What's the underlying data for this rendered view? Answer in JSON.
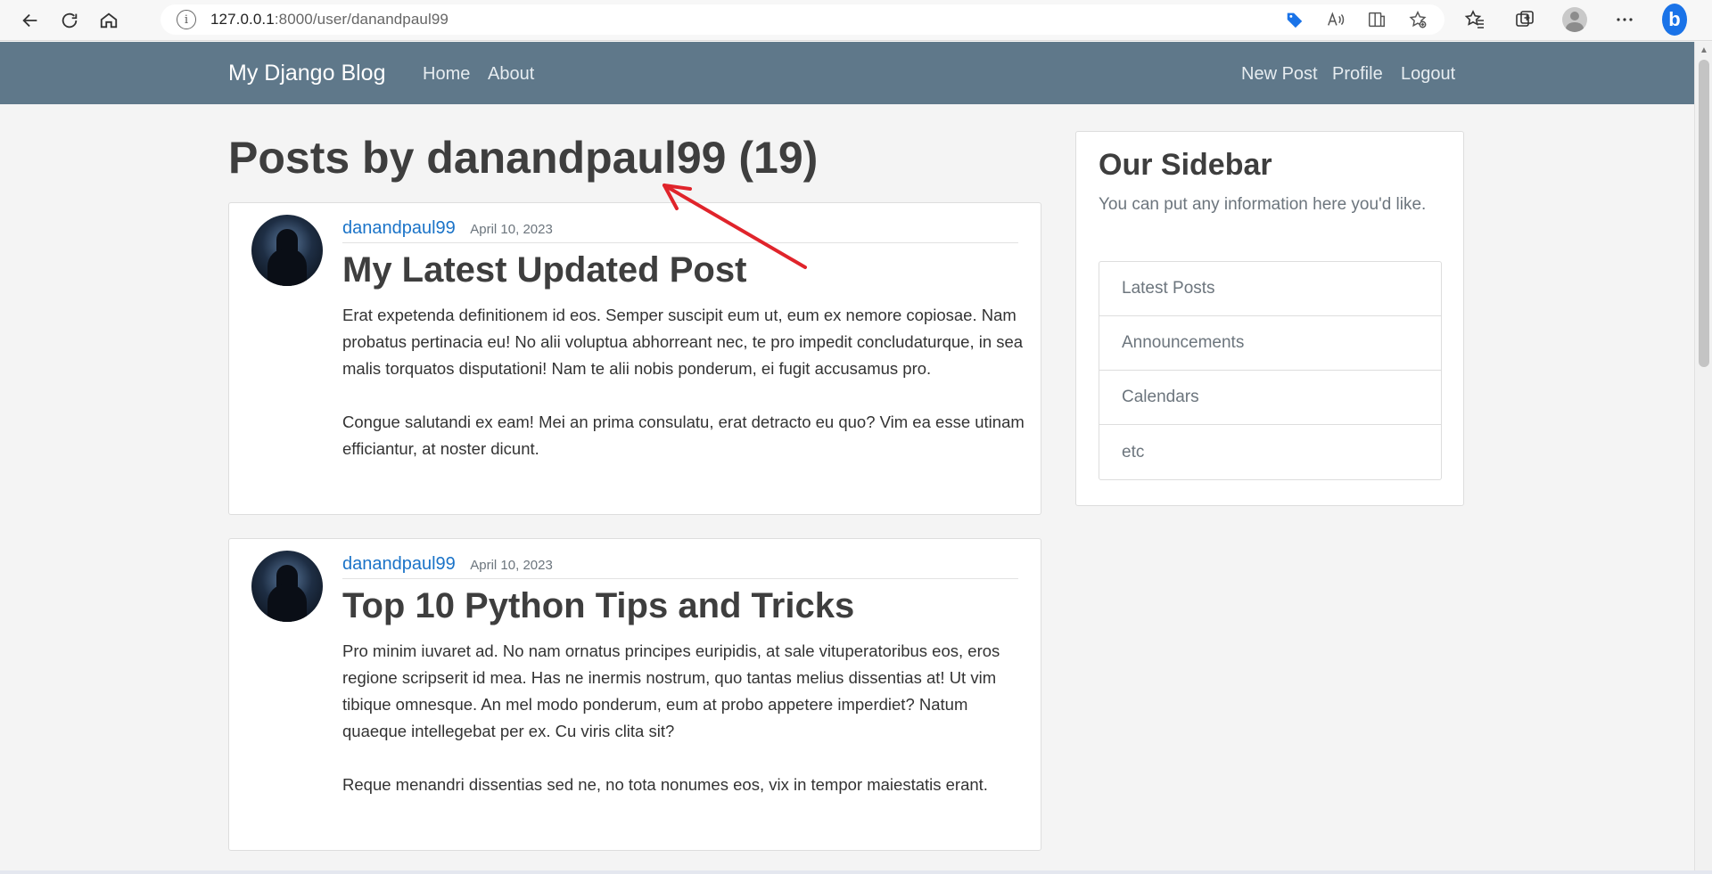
{
  "browser": {
    "url_host": "127.0.0.1",
    "url_rest": ":8000/user/danandpaul99"
  },
  "navbar": {
    "brand": "My Django Blog",
    "links_left": [
      "Home",
      "About"
    ],
    "links_right": [
      "New Post",
      "Profile",
      "Logout"
    ],
    "color": "#5f788a"
  },
  "page": {
    "title": "Posts by danandpaul99 (19)"
  },
  "posts": [
    {
      "author": "danandpaul99",
      "date": "April 10, 2023",
      "title": "My Latest Updated Post",
      "body": "Erat expetenda definitionem id eos. Semper suscipit eum ut, eum ex nemore copiosae. Nam probatus pertinacia eu! No alii voluptua abhorreant nec, te pro impedit concludaturque, in sea malis torquatos disputationi! Nam te alii nobis ponderum, ei fugit accusamus pro.\n\nCongue salutandi ex eam! Mei an prima consulatu, erat detracto eu quo? Vim ea esse utinam efficiantur, at noster dicunt."
    },
    {
      "author": "danandpaul99",
      "date": "April 10, 2023",
      "title": "Top 10 Python Tips and Tricks",
      "body": "Pro minim iuvaret ad. No nam ornatus principes euripidis, at sale vituperatoribus eos, eros regione scripserit id mea. Has ne inermis nostrum, quo tantas melius dissentias at! Ut vim tibique omnesque. An mel modo ponderum, eum at probo appetere imperdiet? Natum quaeque intellegebat per ex. Cu viris clita sit?\n\nReque menandri dissentias sed ne, no tota nonumes eos, vix in tempor maiestatis erant."
    }
  ],
  "sidebar": {
    "title": "Our Sidebar",
    "text": "You can put any information here you'd like.",
    "items": [
      "Latest Posts",
      "Announcements",
      "Calendars",
      "etc"
    ]
  },
  "colors": {
    "link": "#1a73c8",
    "annotation_arrow": "#e0242b"
  }
}
